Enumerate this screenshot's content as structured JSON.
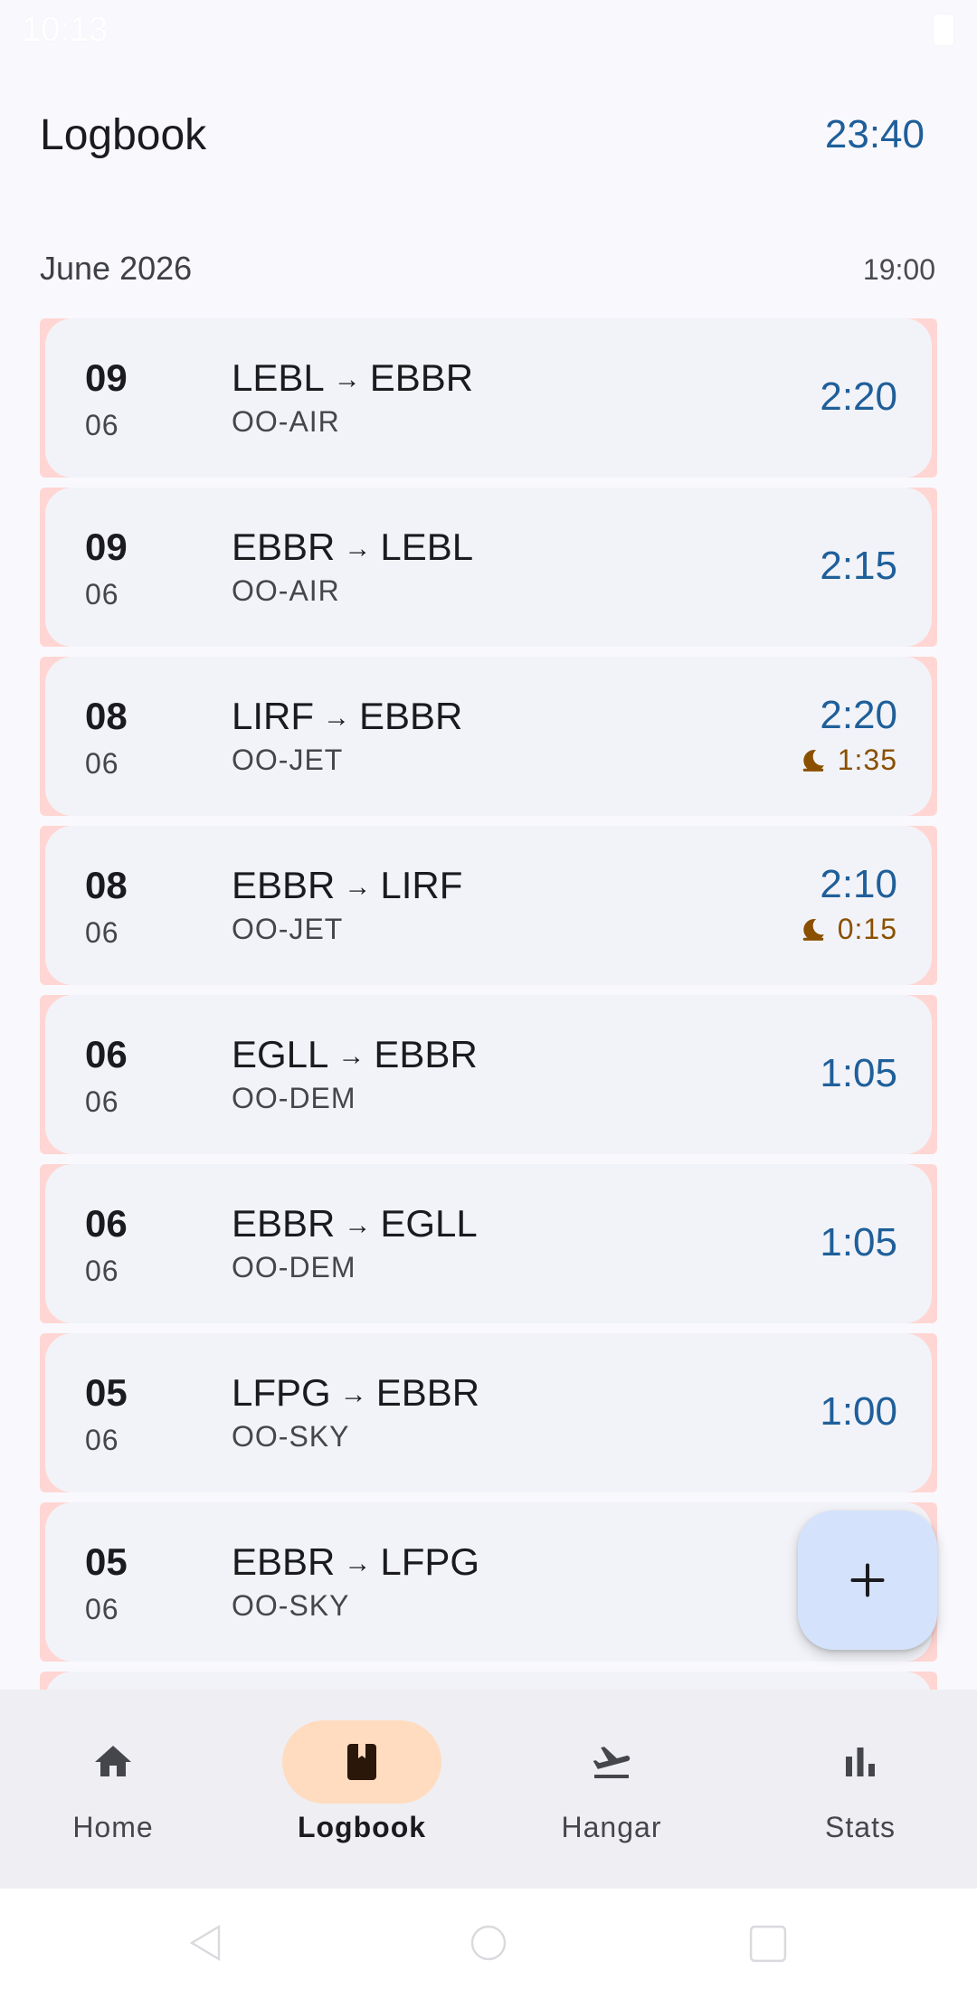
{
  "status_bar": {
    "time": "10:13"
  },
  "header": {
    "title": "Logbook",
    "total": "23:40"
  },
  "month_group": {
    "label": "June 2026",
    "total": "19:00"
  },
  "flights": [
    {
      "day": "09",
      "month": "06",
      "from": "LEBL",
      "arrow": "→",
      "to": "EBBR",
      "aircraft": "OO-AIR",
      "duration": "2:20",
      "night": ""
    },
    {
      "day": "09",
      "month": "06",
      "from": "EBBR",
      "arrow": "→",
      "to": "LEBL",
      "aircraft": "OO-AIR",
      "duration": "2:15",
      "night": ""
    },
    {
      "day": "08",
      "month": "06",
      "from": "LIRF",
      "arrow": "→",
      "to": "EBBR",
      "aircraft": "OO-JET",
      "duration": "2:20",
      "night": "1:35"
    },
    {
      "day": "08",
      "month": "06",
      "from": "EBBR",
      "arrow": "→",
      "to": "LIRF",
      "aircraft": "OO-JET",
      "duration": "2:10",
      "night": "0:15"
    },
    {
      "day": "06",
      "month": "06",
      "from": "EGLL",
      "arrow": "→",
      "to": "EBBR",
      "aircraft": "OO-DEM",
      "duration": "1:05",
      "night": ""
    },
    {
      "day": "06",
      "month": "06",
      "from": "EBBR",
      "arrow": "→",
      "to": "EGLL",
      "aircraft": "OO-DEM",
      "duration": "1:05",
      "night": ""
    },
    {
      "day": "05",
      "month": "06",
      "from": "LFPG",
      "arrow": "→",
      "to": "EBBR",
      "aircraft": "OO-SKY",
      "duration": "1:00",
      "night": ""
    },
    {
      "day": "05",
      "month": "06",
      "from": "EBBR",
      "arrow": "→",
      "to": "LFPG",
      "aircraft": "OO-SKY",
      "duration": "",
      "night": ""
    }
  ],
  "bottom_nav": [
    {
      "label": "Home",
      "icon": "home-icon"
    },
    {
      "label": "Logbook",
      "icon": "book-icon",
      "active": true
    },
    {
      "label": "Hangar",
      "icon": "airplane-takeoff-icon"
    },
    {
      "label": "Stats",
      "icon": "bar-chart-icon"
    }
  ],
  "colors": {
    "accent": "#1f5f9a",
    "night": "#8a5000",
    "row_marker": "#ffd6d3",
    "active_pill": "#ffdcc0",
    "fab": "#d4e3fb"
  }
}
